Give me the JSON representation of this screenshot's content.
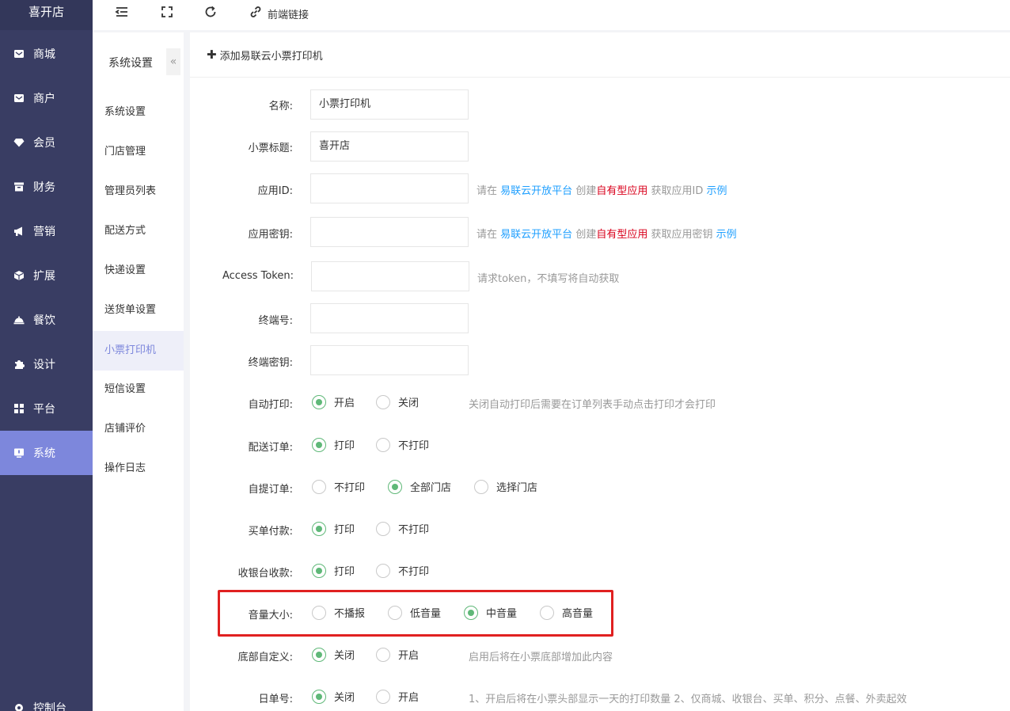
{
  "app": {
    "brand": "喜开店"
  },
  "sidebar": {
    "items": [
      {
        "label": "商城",
        "icon": "mail-icon"
      },
      {
        "label": "商户",
        "icon": "mail-icon"
      },
      {
        "label": "会员",
        "icon": "diamond-icon"
      },
      {
        "label": "财务",
        "icon": "archive-icon"
      },
      {
        "label": "营销",
        "icon": "megaphone-icon"
      },
      {
        "label": "扩展",
        "icon": "cube-icon"
      },
      {
        "label": "餐饮",
        "icon": "cloche-icon"
      },
      {
        "label": "设计",
        "icon": "puzzle-icon"
      },
      {
        "label": "平台",
        "icon": "grid-icon"
      },
      {
        "label": "系统",
        "icon": "monitor-icon",
        "active": true
      }
    ],
    "bottom_label": "控制台"
  },
  "topbar": {
    "frontend_link": "前端链接"
  },
  "subnav": {
    "title": "系统设置",
    "collapse_glyph": "«",
    "items": [
      "系统设置",
      "门店管理",
      "管理员列表",
      "配送方式",
      "快递设置",
      "送货单设置",
      "小票打印机",
      "短信设置",
      "店铺评价",
      "操作日志"
    ],
    "active": "小票打印机"
  },
  "card": {
    "title": "添加易联云小票打印机"
  },
  "form": {
    "name": {
      "label": "名称:",
      "value": "小票打印机"
    },
    "ticket_title": {
      "label": "小票标题:",
      "value": "喜开店"
    },
    "app_id": {
      "label": "应用ID:",
      "value": "",
      "hint_a": "请在",
      "hint_link": "易联云开放平台",
      "hint_b": "创建",
      "hint_red": "自有型应用",
      "hint_c": "获取应用ID",
      "hint_example": "示例"
    },
    "app_secret": {
      "label": "应用密钥:",
      "value": "",
      "hint_a": "请在",
      "hint_link": "易联云开放平台",
      "hint_b": "创建",
      "hint_red": "自有型应用",
      "hint_c": "获取应用密钥",
      "hint_example": "示例"
    },
    "access_token": {
      "label": "Access Token:",
      "value": "",
      "hint": "请求token，不填写将自动获取"
    },
    "terminal_no": {
      "label": "终端号:",
      "value": ""
    },
    "terminal_secret": {
      "label": "终端密钥:",
      "value": ""
    },
    "auto_print": {
      "label": "自动打印:",
      "options": [
        "开启",
        "关闭"
      ],
      "selected": 0,
      "hint": "关闭自动打印后需要在订单列表手动点击打印才会打印"
    },
    "delivery_order": {
      "label": "配送订单:",
      "options": [
        "打印",
        "不打印"
      ],
      "selected": 0
    },
    "pickup_order": {
      "label": "自提订单:",
      "options": [
        "不打印",
        "全部门店",
        "选择门店"
      ],
      "selected": 1
    },
    "bill_pay": {
      "label": "买单付款:",
      "options": [
        "打印",
        "不打印"
      ],
      "selected": 0
    },
    "cashier": {
      "label": "收银台收款:",
      "options": [
        "打印",
        "不打印"
      ],
      "selected": 0
    },
    "volume": {
      "label": "音量大小:",
      "options": [
        "不播报",
        "低音量",
        "中音量",
        "高音量"
      ],
      "selected": 2
    },
    "footer_custom": {
      "label": "底部自定义:",
      "options": [
        "关闭",
        "开启"
      ],
      "selected": 0,
      "hint": "启用后将在小票底部增加此内容"
    },
    "daily_no": {
      "label": "日单号:",
      "options": [
        "关闭",
        "开启"
      ],
      "selected": 0,
      "hint": "1、开启后将在小票头部显示一天的打印数量 2、仅商城、收银台、买单、积分、点餐、外卖起效"
    }
  }
}
